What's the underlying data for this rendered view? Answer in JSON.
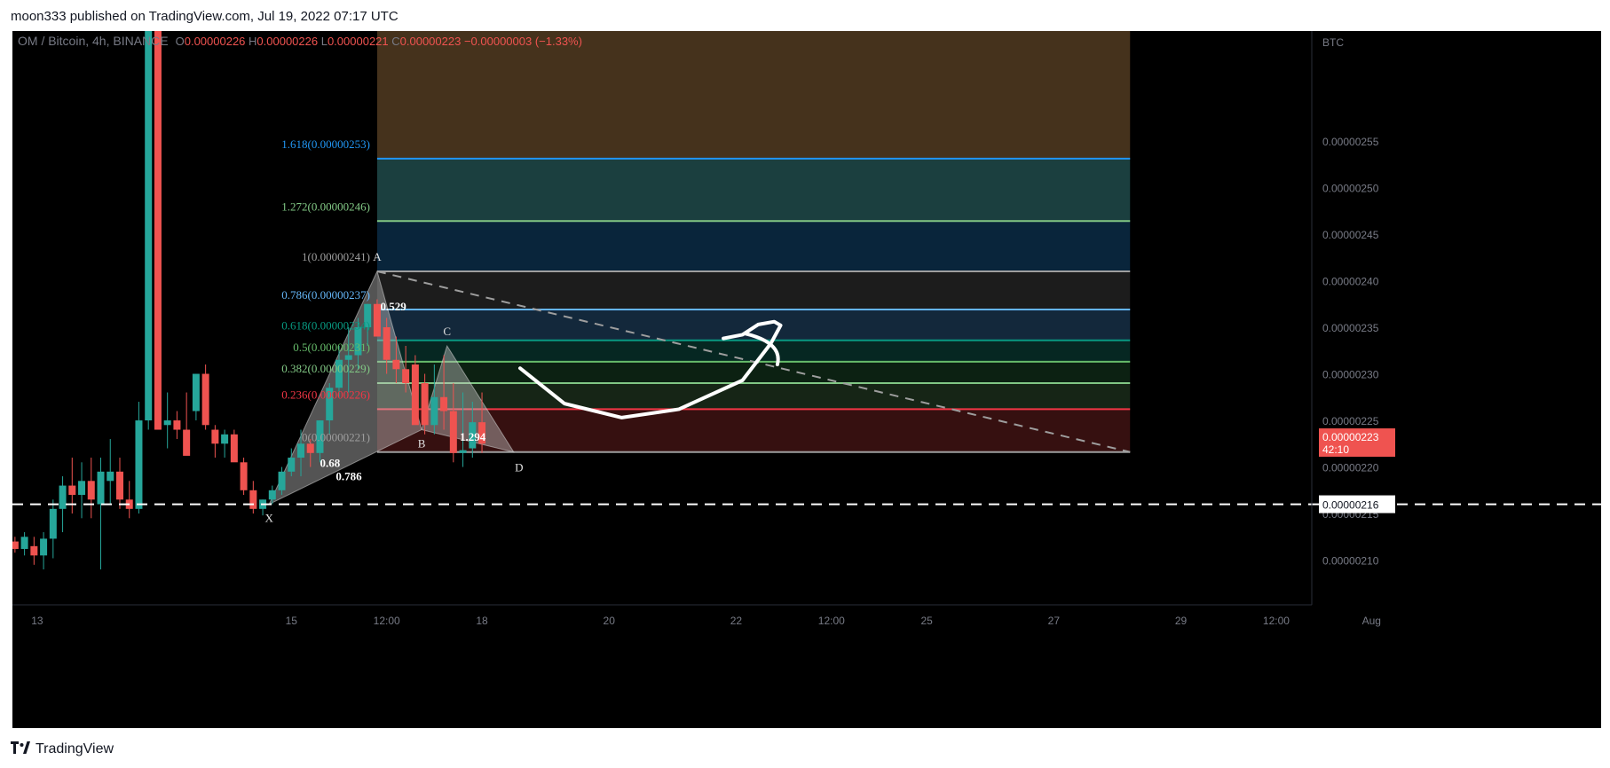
{
  "header": {
    "text": "moon333 published on TradingView.com, Jul 19, 2022 07:17 UTC"
  },
  "footer": {
    "logo_icon": "tradingview-logo-icon",
    "brand": "TradingView"
  },
  "colors": {
    "up": "#26a69a",
    "down": "#ef5350",
    "fib_1618": "#2196f3",
    "fib_1272": "#81c784",
    "fib_786": "#64b5f6",
    "fib_618": "#089981",
    "fib_5": "#4caf50",
    "fib_382": "#81c784",
    "fib_236": "#f23645",
    "fib_neutral": "#787b86"
  },
  "chart_data": {
    "type": "candlestick",
    "symbol_line": {
      "name": "OM / Bitcoin, 4h, BINANCE",
      "o_label": "O",
      "o": "0.00000226",
      "h_label": "H",
      "h": "0.00000226",
      "l_label": "L",
      "l": "0.00000221",
      "c_label": "C",
      "c": "0.00000223",
      "change": "−0.00000003 (−1.33%)"
    },
    "currency": "BTC",
    "y_ticks": [
      "0.00000255",
      "0.00000250",
      "0.00000245",
      "0.00000240",
      "0.00000235",
      "0.00000230",
      "0.00000225",
      "0.00000220",
      "0.00000215",
      "0.00000210"
    ],
    "y_tick_values": [
      255,
      250,
      245,
      240,
      235,
      230,
      225,
      220,
      215,
      210
    ],
    "y_range": [
      205.2,
      266.8
    ],
    "x_ticks": [
      {
        "label": "13",
        "x": -2
      },
      {
        "label": "15",
        "x": 2
      },
      {
        "label": "12:00",
        "x": 3.5
      },
      {
        "label": "18",
        "x": 5
      },
      {
        "label": "20",
        "x": 7
      },
      {
        "label": "22",
        "x": 9
      },
      {
        "label": "12:00",
        "x": 10.5
      },
      {
        "label": "25",
        "x": 12
      },
      {
        "label": "27",
        "x": 14
      },
      {
        "label": "29",
        "x": 16
      },
      {
        "label": "12:00",
        "x": 17.5
      },
      {
        "label": "Aug",
        "x": 19
      }
    ],
    "x_range": [
      -2.39,
      18.06
    ],
    "candles": [
      [
        -2.35,
        212,
        212.5,
        210.8,
        211.2
      ],
      [
        -2.2,
        211.2,
        213,
        210.5,
        212.5
      ],
      [
        -2.05,
        211.5,
        212.5,
        209.5,
        210.5
      ],
      [
        -1.9,
        210.5,
        213,
        209,
        212.3
      ],
      [
        -1.75,
        212.3,
        216.5,
        210.2,
        215.5
      ],
      [
        -1.6,
        215.5,
        219,
        213,
        218
      ],
      [
        -1.45,
        218,
        221,
        215,
        217
      ],
      [
        -1.3,
        217,
        220.5,
        214.5,
        218.5
      ],
      [
        -1.15,
        218.5,
        221,
        214.5,
        216.5
      ],
      [
        -1,
        216,
        221,
        209,
        219.5
      ],
      [
        -0.85,
        218.5,
        223,
        216,
        219.5
      ],
      [
        -0.7,
        219.5,
        221,
        215.5,
        216.5
      ],
      [
        -0.55,
        216.5,
        218.5,
        214.5,
        215.5
      ],
      [
        -0.4,
        215.5,
        227,
        215,
        225
      ],
      [
        -0.25,
        225,
        282,
        224,
        282
      ],
      [
        -0.1,
        282,
        282,
        224,
        224
      ],
      [
        0.05,
        224.5,
        228,
        222,
        225
      ],
      [
        0.2,
        225,
        226,
        223,
        224
      ],
      [
        0.35,
        224,
        228,
        222.5,
        221.2
      ],
      [
        0.5,
        226,
        230,
        225,
        230
      ],
      [
        0.65,
        230,
        231,
        224,
        224.5
      ],
      [
        0.8,
        224,
        224.5,
        221,
        222.5
      ],
      [
        0.95,
        222.5,
        224,
        221,
        223.5
      ],
      [
        1.1,
        223.5,
        224,
        221,
        220.5
      ],
      [
        1.25,
        220.5,
        221,
        217,
        217.5
      ],
      [
        1.4,
        217.5,
        218.5,
        215,
        215.5
      ],
      [
        1.55,
        215.5,
        216.5,
        214.8,
        216.5
      ],
      [
        1.7,
        216.5,
        218,
        216,
        217.5
      ],
      [
        1.85,
        217.5,
        220,
        217,
        219.5
      ],
      [
        2,
        219.5,
        222,
        219,
        221
      ],
      [
        2.15,
        221,
        224,
        219,
        222.5
      ],
      [
        2.3,
        222.5,
        223,
        220,
        221.5
      ],
      [
        2.45,
        221.5,
        225,
        220.5,
        225
      ],
      [
        2.6,
        225,
        229,
        223.5,
        228.5
      ],
      [
        2.75,
        228.5,
        233,
        227.5,
        231.5
      ],
      [
        2.9,
        231.5,
        235,
        228,
        232
      ],
      [
        3.05,
        232,
        236,
        230.5,
        235
      ],
      [
        3.2,
        235,
        237.5,
        233,
        237.5
      ],
      [
        3.35,
        237.5,
        238,
        234,
        234
      ],
      [
        3.5,
        235,
        236,
        230,
        231.5
      ],
      [
        3.65,
        231.5,
        234,
        229,
        230.5
      ],
      [
        3.8,
        230.5,
        233,
        228,
        229
      ],
      [
        3.95,
        231,
        232,
        228,
        224.5
      ],
      [
        4.1,
        229,
        230,
        223.5,
        224.5
      ],
      [
        4.25,
        224.5,
        231,
        223.5,
        227.5
      ],
      [
        4.4,
        227.5,
        232,
        224,
        226
      ],
      [
        4.55,
        226,
        229,
        220.5,
        221.5
      ],
      [
        4.7,
        221.5,
        228,
        220,
        221.8
      ],
      [
        4.85,
        222,
        227,
        221,
        224.8
      ],
      [
        5.0,
        224.8,
        228,
        221.5,
        222.5
      ]
    ],
    "fib_levels": [
      {
        "label": "1.618(0.00000253)",
        "price": 253.1,
        "color": "#2196f3"
      },
      {
        "label": "1.272(0.00000246)",
        "price": 246.4,
        "color": "#81c784"
      },
      {
        "label": "1(0.00000241)",
        "price": 241.0,
        "color": "#9e9e9e"
      },
      {
        "label": "0.786(0.00000237)",
        "price": 236.9,
        "color": "#64b5f6"
      },
      {
        "label": "0.618(0.00000234)",
        "price": 233.6,
        "color": "#089981"
      },
      {
        "label": "0.5(0.00000231)",
        "price": 231.3,
        "color": "#66bb6a"
      },
      {
        "label": "0.382(0.00000229)",
        "price": 229.0,
        "color": "#81c784"
      },
      {
        "label": "0.236(0.00000226)",
        "price": 226.2,
        "color": "#f23645"
      },
      {
        "label": "0(0.00000221)",
        "price": 221.6,
        "color": "#9e9e9e"
      }
    ],
    "fib_x_range": [
      3.35,
      15.2
    ],
    "harmonic": {
      "points": [
        {
          "label": "X",
          "x": 1.65,
          "price": 216.0
        },
        {
          "label": "A",
          "x": 3.35,
          "price": 241.0
        },
        {
          "label": "B",
          "x": 4.05,
          "price": 224.0
        },
        {
          "label": "C",
          "x": 4.45,
          "price": 233.0
        },
        {
          "label": "D",
          "x": 5.5,
          "price": 221.6
        }
      ],
      "ratios": [
        {
          "label": "0.529",
          "x": 3.4,
          "price": 236.8
        },
        {
          "label": "0.68",
          "x": 2.45,
          "price": 220.0
        },
        {
          "label": "0.786",
          "x": 2.7,
          "price": 218.6
        },
        {
          "label": "1.294",
          "x": 4.65,
          "price": 222.8
        }
      ]
    },
    "support_line": {
      "price": 216.0,
      "label": "0.00000216"
    },
    "last_price": {
      "price": 223.0,
      "label": "0.00000223",
      "countdown": "42:10"
    },
    "trend_line": {
      "x1": 3.35,
      "p1": 241.0,
      "x2": 15.2,
      "p2": 221.6
    },
    "forecast_path": [
      [
        5.6,
        230.6
      ],
      [
        6.3,
        226.8
      ],
      [
        7.2,
        225.3
      ],
      [
        8.1,
        226.2
      ],
      [
        9.1,
        229.3
      ],
      [
        9.55,
        233.3
      ],
      [
        9.7,
        235.2
      ],
      [
        9.6,
        235.6
      ],
      [
        9.35,
        235.3
      ],
      [
        9.1,
        234.2
      ],
      [
        8.8,
        233.8
      ]
    ],
    "forecast_arrow_tail": [
      [
        9.15,
        234.3
      ],
      [
        9.65,
        231.0
      ]
    ]
  }
}
